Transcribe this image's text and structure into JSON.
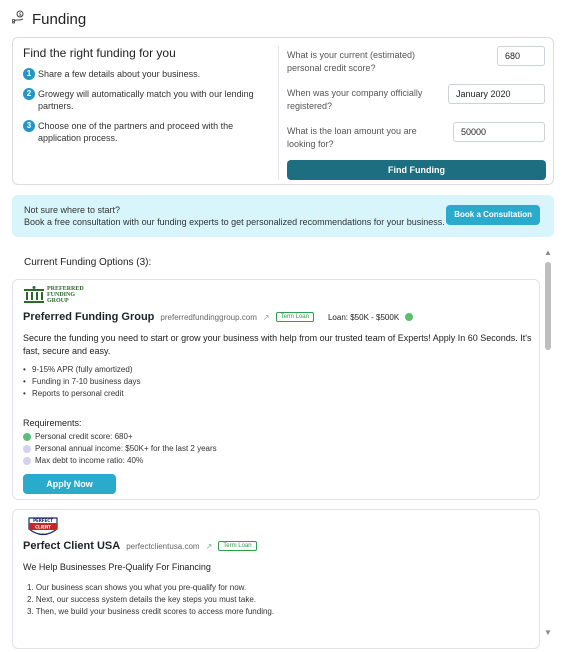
{
  "header": {
    "title": "Funding",
    "icon": "money-hand-icon"
  },
  "steps": {
    "heading": "Find the right funding for you",
    "items": [
      {
        "num": "1",
        "text": "Share a few details about your business."
      },
      {
        "num": "2",
        "text": "Growegy will automatically match you with our lending partners."
      },
      {
        "num": "3",
        "text": "Choose one of the partners and proceed with the application process."
      }
    ]
  },
  "form": {
    "credit_label": "What is your current (estimated) personal credit score?",
    "credit_value": "680",
    "registered_label": "When was your company officially registered?",
    "registered_value": "January 2020",
    "loan_label": "What is the loan amount you are looking for?",
    "loan_value": "50000",
    "submit_label": "Find Funding"
  },
  "consultation": {
    "line1": "Not sure where to start?",
    "line2": "Book a free consultation with our funding experts to get personalized recommendations for your business.",
    "button_label": "Book a Consultation"
  },
  "options": {
    "title": "Current Funding Options (3):",
    "cards": [
      {
        "logo_lines": [
          "PREFERRED",
          "FUNDING",
          "GROUP"
        ],
        "name": "Preferred Funding Group",
        "site": "preferredfundinggroup.com",
        "tag": "Term Loan",
        "loan": "Loan: $50K - $500K",
        "description": "Secure the funding you need to start or grow your business with help from our trusted team of Experts! Apply In 60 Seconds. It's fast, secure and easy.",
        "bullets": [
          "9-15% APR (fully amortized)",
          "Funding in 7-10 business days",
          "Reports to personal credit"
        ],
        "requirements_title": "Requirements:",
        "requirements": [
          {
            "text": "Personal credit score: 680+",
            "status": "met"
          },
          {
            "text": "Personal annual income: $50K+ for the last 2 years",
            "status": "unknown"
          },
          {
            "text": "Max debt to income ratio: 40%",
            "status": "unknown"
          }
        ],
        "apply_label": "Apply Now"
      },
      {
        "logo_lines": [
          "PERFECT",
          "CLIENT"
        ],
        "name": "Perfect Client USA",
        "site": "perfectclientusa.com",
        "tag": "Term Loan",
        "description": "We Help Businesses Pre-Qualify For Financing",
        "steps": [
          "1. Our business scan shows you what you pre-qualify for now.",
          "2. Next, our success system details the key steps you must take.",
          "3. Then, we build your business credit scores to access more funding."
        ]
      }
    ]
  },
  "colors": {
    "accent": "#2aabcb",
    "primary_dark": "#1d6e80",
    "consult_bg": "#d8f5fb",
    "tag_green": "#2e9e4f"
  }
}
